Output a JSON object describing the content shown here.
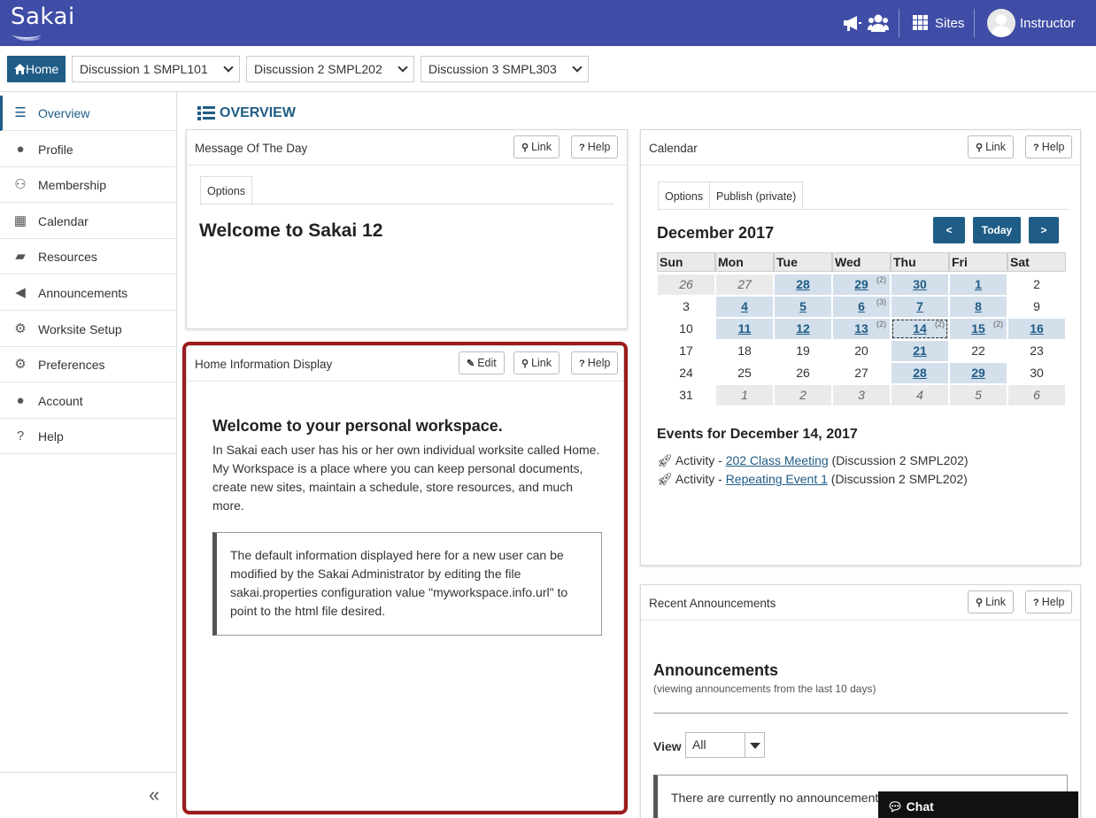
{
  "app": {
    "logo": "Sakai"
  },
  "topbar": {
    "sites_label": "Sites",
    "user_name": "Instructor"
  },
  "sitenav": {
    "home_label": "Home",
    "tabs": [
      {
        "label": "Discussion 1 SMPL101"
      },
      {
        "label": "Discussion 2 SMPL202"
      },
      {
        "label": "Discussion 3 SMPL303"
      }
    ]
  },
  "sidebar": {
    "items": [
      {
        "label": "Overview",
        "icon": "list-icon"
      },
      {
        "label": "Profile",
        "icon": "user-icon"
      },
      {
        "label": "Membership",
        "icon": "users-icon"
      },
      {
        "label": "Calendar",
        "icon": "calendar-icon"
      },
      {
        "label": "Resources",
        "icon": "folder-icon"
      },
      {
        "label": "Announcements",
        "icon": "megaphone-icon"
      },
      {
        "label": "Worksite Setup",
        "icon": "gears-icon"
      },
      {
        "label": "Preferences",
        "icon": "gear-icon"
      },
      {
        "label": "Account",
        "icon": "user-icon"
      },
      {
        "label": "Help",
        "icon": "question-icon"
      }
    ],
    "collapse_glyph": "«"
  },
  "page": {
    "title": "OVERVIEW"
  },
  "buttons": {
    "link": "Link",
    "help": "Help",
    "edit": "Edit"
  },
  "motd": {
    "title": "Message Of The Day",
    "tab_options": "Options",
    "heading": "Welcome to Sakai 12"
  },
  "home_info": {
    "title": "Home Information Display",
    "heading": "Welcome to your personal workspace.",
    "paragraph": "In Sakai each user has his or her own individual worksite called Home. My Workspace is a place where you can keep personal documents, create new sites, maintain a schedule, store resources, and much more.",
    "quote": "The default information displayed here for a new user can be modified by the Sakai Administrator by editing the file sakai.properties configuration value \"myworkspace.info.url\" to point to the html file desired."
  },
  "calendar": {
    "title": "Calendar",
    "tab_options": "Options",
    "tab_publish": "Publish (private)",
    "month": "December 2017",
    "prev": "<",
    "today": "Today",
    "next": ">",
    "weekdays": [
      "Sun",
      "Mon",
      "Tue",
      "Wed",
      "Thu",
      "Fri",
      "Sat"
    ],
    "weeks": [
      [
        {
          "d": "26",
          "t": "other"
        },
        {
          "d": "27",
          "t": "other"
        },
        {
          "d": "28",
          "t": "event"
        },
        {
          "d": "29",
          "t": "event",
          "n": "(2)"
        },
        {
          "d": "30",
          "t": "event"
        },
        {
          "d": "1",
          "t": "event"
        },
        {
          "d": "2",
          "t": "plain"
        }
      ],
      [
        {
          "d": "3",
          "t": "plain"
        },
        {
          "d": "4",
          "t": "event"
        },
        {
          "d": "5",
          "t": "event"
        },
        {
          "d": "6",
          "t": "event",
          "n": "(3)"
        },
        {
          "d": "7",
          "t": "event"
        },
        {
          "d": "8",
          "t": "event"
        },
        {
          "d": "9",
          "t": "plain"
        }
      ],
      [
        {
          "d": "10",
          "t": "plain"
        },
        {
          "d": "11",
          "t": "event"
        },
        {
          "d": "12",
          "t": "event"
        },
        {
          "d": "13",
          "t": "event",
          "n": "(2)"
        },
        {
          "d": "14",
          "t": "today",
          "n": "(2)"
        },
        {
          "d": "15",
          "t": "event",
          "n": "(2)"
        },
        {
          "d": "16",
          "t": "event"
        }
      ],
      [
        {
          "d": "17",
          "t": "plain"
        },
        {
          "d": "18",
          "t": "plain"
        },
        {
          "d": "19",
          "t": "plain"
        },
        {
          "d": "20",
          "t": "plain"
        },
        {
          "d": "21",
          "t": "event"
        },
        {
          "d": "22",
          "t": "plain"
        },
        {
          "d": "23",
          "t": "plain"
        }
      ],
      [
        {
          "d": "24",
          "t": "plain"
        },
        {
          "d": "25",
          "t": "plain"
        },
        {
          "d": "26",
          "t": "plain"
        },
        {
          "d": "27",
          "t": "plain"
        },
        {
          "d": "28",
          "t": "event"
        },
        {
          "d": "29",
          "t": "event"
        },
        {
          "d": "30",
          "t": "plain"
        }
      ],
      [
        {
          "d": "31",
          "t": "plain"
        },
        {
          "d": "1",
          "t": "other"
        },
        {
          "d": "2",
          "t": "other"
        },
        {
          "d": "3",
          "t": "other"
        },
        {
          "d": "4",
          "t": "other"
        },
        {
          "d": "5",
          "t": "other"
        },
        {
          "d": "6",
          "t": "other"
        }
      ]
    ],
    "events_title": "Events for December 14, 2017",
    "events": [
      {
        "type": "Activity - ",
        "link": "202 Class Meeting",
        "site": " (Discussion 2 SMPL202)"
      },
      {
        "type": "Activity - ",
        "link": "Repeating Event 1",
        "site": " (Discussion 2 SMPL202)"
      }
    ]
  },
  "announcements": {
    "title": "Recent Announcements",
    "heading": "Announcements",
    "subtitle": "(viewing announcements from the last 10 days)",
    "view_label": "View",
    "view_value": "All",
    "empty_text": "There are currently no announcements"
  },
  "chat": {
    "label": "Chat"
  },
  "colors": {
    "topbar": "#3f4da6",
    "primary": "#1f5c86",
    "highlight": "#9b1c1c",
    "event_cell": "#d3dfeb"
  }
}
